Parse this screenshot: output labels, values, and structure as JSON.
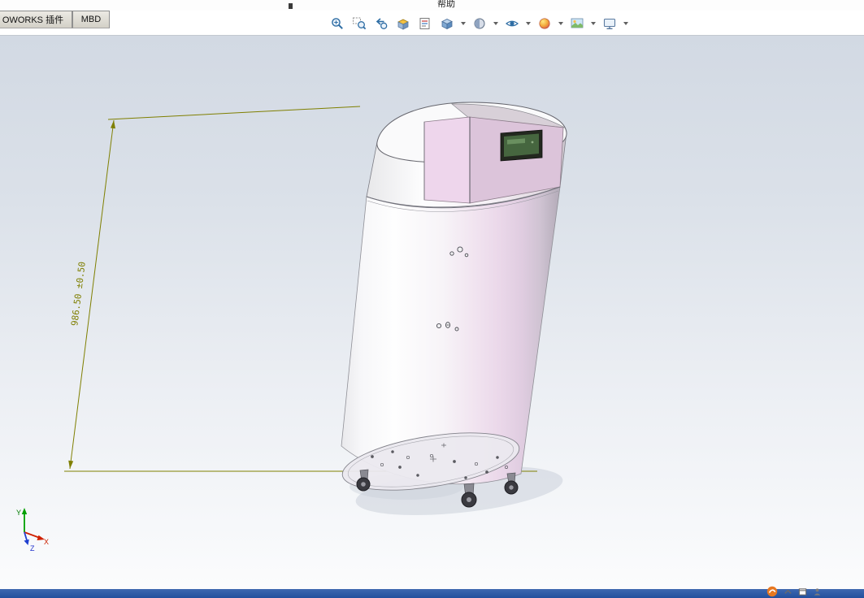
{
  "menu": {
    "fragment_text": "帮助"
  },
  "command_tabs": [
    {
      "label": "OWORKS 插件"
    },
    {
      "label": "MBD"
    }
  ],
  "headsup_toolbar": {
    "icons": [
      {
        "name": "zoom-to-fit-icon",
        "has_dropdown": false
      },
      {
        "name": "zoom-to-area-icon",
        "has_dropdown": false
      },
      {
        "name": "previous-view-icon",
        "has_dropdown": false
      },
      {
        "name": "section-view-icon",
        "has_dropdown": false
      },
      {
        "name": "dynamic-annotation-views-icon",
        "has_dropdown": false
      },
      {
        "name": "view-orientation-icon",
        "has_dropdown": true
      },
      {
        "name": "display-style-icon",
        "has_dropdown": true
      },
      {
        "name": "hide-show-items-icon",
        "has_dropdown": true
      },
      {
        "name": "edit-appearance-icon",
        "has_dropdown": true
      },
      {
        "name": "apply-scene-icon",
        "has_dropdown": true
      },
      {
        "name": "view-settings-icon",
        "has_dropdown": true
      }
    ]
  },
  "viewport": {
    "dimension": {
      "text": "986.50 ±0.50",
      "color": "#7f7f00"
    },
    "triad": {
      "y_label": "Y",
      "x_label": "X",
      "z_label": "Z",
      "y_color": "#007a00",
      "x_color": "#cc2200",
      "z_color": "#2233cc"
    },
    "model_colors": {
      "body": "#f4f1f5",
      "pink_accent": "#ead7e9",
      "display_screen": "#46663f"
    }
  },
  "taskbar": {
    "color": "#2a57a8"
  },
  "tray_icons": [
    {
      "name": "orange-logo-icon"
    },
    {
      "name": "chevron-up-icon"
    },
    {
      "name": "window-icon"
    },
    {
      "name": "person-icon"
    }
  ]
}
